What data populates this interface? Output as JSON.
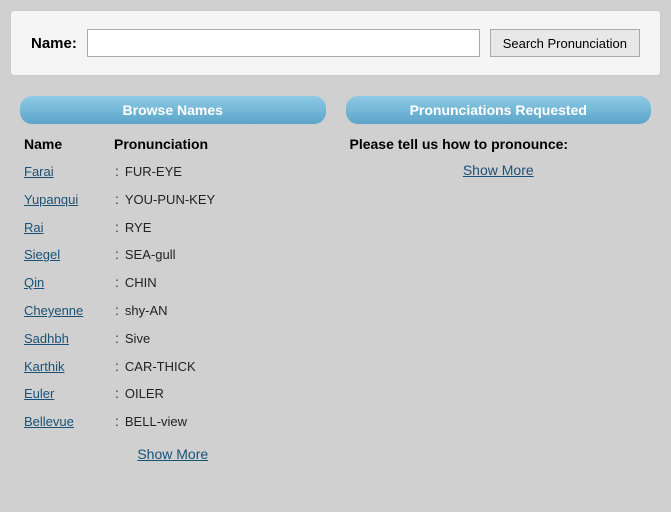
{
  "search": {
    "label": "Name:",
    "placeholder": "",
    "button_label": "Search Pronunciation"
  },
  "browse_panel": {
    "header": "Browse Names",
    "col_name": "Name",
    "col_pronunciation": "Pronunciation",
    "names": [
      {
        "name": "Farai",
        "pronunciation": "FUR-EYE"
      },
      {
        "name": "Yupanqui",
        "pronunciation": "YOU-PUN-KEY"
      },
      {
        "name": "Rai",
        "pronunciation": "RYE"
      },
      {
        "name": "Siegel",
        "pronunciation": "SEA-gull"
      },
      {
        "name": "Qin",
        "pronunciation": "CHIN"
      },
      {
        "name": "Cheyenne",
        "pronunciation": "shy-AN"
      },
      {
        "name": "Sadhbh",
        "pronunciation": "Sive"
      },
      {
        "name": "Karthik",
        "pronunciation": "CAR-THICK"
      },
      {
        "name": "Euler",
        "pronunciation": "OILER"
      },
      {
        "name": "Bellevue",
        "pronunciation": "BELL-view"
      }
    ],
    "show_more": "Show More"
  },
  "pronunciations_panel": {
    "header": "Pronunciations Requested",
    "subtext": "Please tell us how to pronounce:",
    "show_more": "Show More"
  }
}
